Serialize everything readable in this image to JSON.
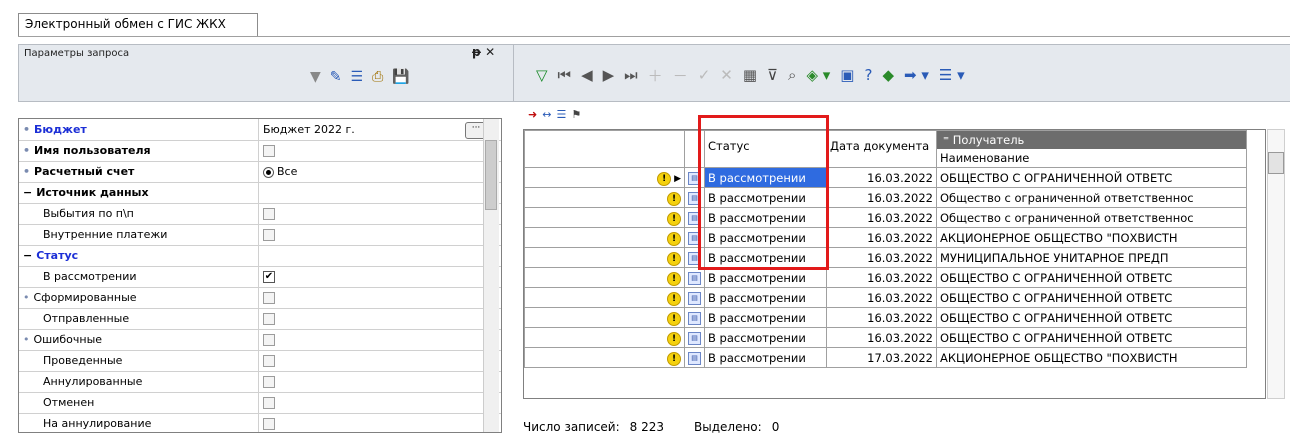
{
  "tab": {
    "label": "Электронный обмен с ГИС ЖКХ"
  },
  "left_panel": {
    "title": "Параметры запроса",
    "pin_icon": "pin-icon",
    "close_icon": "close-icon",
    "toolbar": [
      "filter-icon",
      "brush-icon",
      "list-icon",
      "print-icon",
      "save-icon"
    ],
    "rows": [
      {
        "name": "Бюджет",
        "style": "blue",
        "marker": "•",
        "value": "Бюджет 2022 г.",
        "type": "ellipsis"
      },
      {
        "name": "Имя пользователя",
        "style": "bold",
        "marker": "•",
        "value": "",
        "type": "check",
        "checked": false
      },
      {
        "name": "Расчетный счет",
        "style": "bold",
        "marker": "•",
        "value": "Все",
        "type": "radio"
      },
      {
        "name": "Источник данных",
        "style": "bold",
        "marker": "−",
        "value": "",
        "type": "none"
      },
      {
        "name": "Выбытия по п\\п",
        "style": "",
        "marker": "",
        "value": "",
        "type": "check",
        "checked": false
      },
      {
        "name": "Внутренние платежи",
        "style": "",
        "marker": "",
        "value": "",
        "type": "check",
        "checked": false
      },
      {
        "name": "Статус",
        "style": "blue",
        "marker": "−",
        "value": "",
        "type": "none"
      },
      {
        "name": "В рассмотрении",
        "style": "",
        "marker": "",
        "value": "",
        "type": "check",
        "checked": true
      },
      {
        "name": "Сформированные",
        "style": "",
        "marker": "•",
        "value": "",
        "type": "check",
        "checked": false
      },
      {
        "name": "Отправленные",
        "style": "",
        "marker": "",
        "value": "",
        "type": "check",
        "checked": false
      },
      {
        "name": "Ошибочные",
        "style": "",
        "marker": "•",
        "value": "",
        "type": "check",
        "checked": false
      },
      {
        "name": "Проведенные",
        "style": "",
        "marker": "",
        "value": "",
        "type": "check",
        "checked": false
      },
      {
        "name": "Аннулированные",
        "style": "",
        "marker": "",
        "value": "",
        "type": "check",
        "checked": false
      },
      {
        "name": "Отменен",
        "style": "",
        "marker": "",
        "value": "",
        "type": "check",
        "checked": false
      },
      {
        "name": "На аннулирование",
        "style": "",
        "marker": "",
        "value": "",
        "type": "check",
        "checked": false
      }
    ]
  },
  "grid": {
    "headers": {
      "status": "Статус",
      "date": "Дата документа",
      "recipient_group": "Получатель",
      "recipient_name": "Наименование"
    },
    "rows": [
      {
        "status": "В рассмотрении",
        "date": "16.03.2022",
        "name": "ОБЩЕСТВО С ОГРАНИЧЕННОЙ ОТВЕТС",
        "current": true,
        "selected": true
      },
      {
        "status": "В рассмотрении",
        "date": "16.03.2022",
        "name": "Общество с ограниченной ответственнос",
        "current": false,
        "selected": false
      },
      {
        "status": "В рассмотрении",
        "date": "16.03.2022",
        "name": "Общество с ограниченной ответственнос",
        "current": false,
        "selected": false
      },
      {
        "status": "В рассмотрении",
        "date": "16.03.2022",
        "name": "АКЦИОНЕРНОЕ ОБЩЕСТВО \"ПОХВИСТН",
        "current": false,
        "selected": false
      },
      {
        "status": "В рассмотрении",
        "date": "16.03.2022",
        "name": "МУНИЦИПАЛЬНОЕ УНИТАРНОЕ ПРЕДП",
        "current": false,
        "selected": false
      },
      {
        "status": "В рассмотрении",
        "date": "16.03.2022",
        "name": "ОБЩЕСТВО С ОГРАНИЧЕННОЙ ОТВЕТС",
        "current": false,
        "selected": false
      },
      {
        "status": "В рассмотрении",
        "date": "16.03.2022",
        "name": "ОБЩЕСТВО С ОГРАНИЧЕННОЙ ОТВЕТС",
        "current": false,
        "selected": false
      },
      {
        "status": "В рассмотрении",
        "date": "16.03.2022",
        "name": "ОБЩЕСТВО С ОГРАНИЧЕННОЙ ОТВЕТС",
        "current": false,
        "selected": false
      },
      {
        "status": "В рассмотрении",
        "date": "16.03.2022",
        "name": "ОБЩЕСТВО С ОГРАНИЧЕННОЙ ОТВЕТС",
        "current": false,
        "selected": false
      },
      {
        "status": "В рассмотрении",
        "date": "17.03.2022",
        "name": "АКЦИОНЕРНОЕ ОБЩЕСТВО \"ПОХВИСТН",
        "current": false,
        "selected": false
      }
    ]
  },
  "status_bar": {
    "records_label": "Число записей:",
    "records_value": "8 223",
    "selected_label": "Выделено:",
    "selected_value": "0"
  },
  "colors": {
    "accent_blue": "#1c2fd6",
    "selection": "#2f6be0",
    "highlight": "#e21a1a",
    "warning": "#f4d10e"
  }
}
